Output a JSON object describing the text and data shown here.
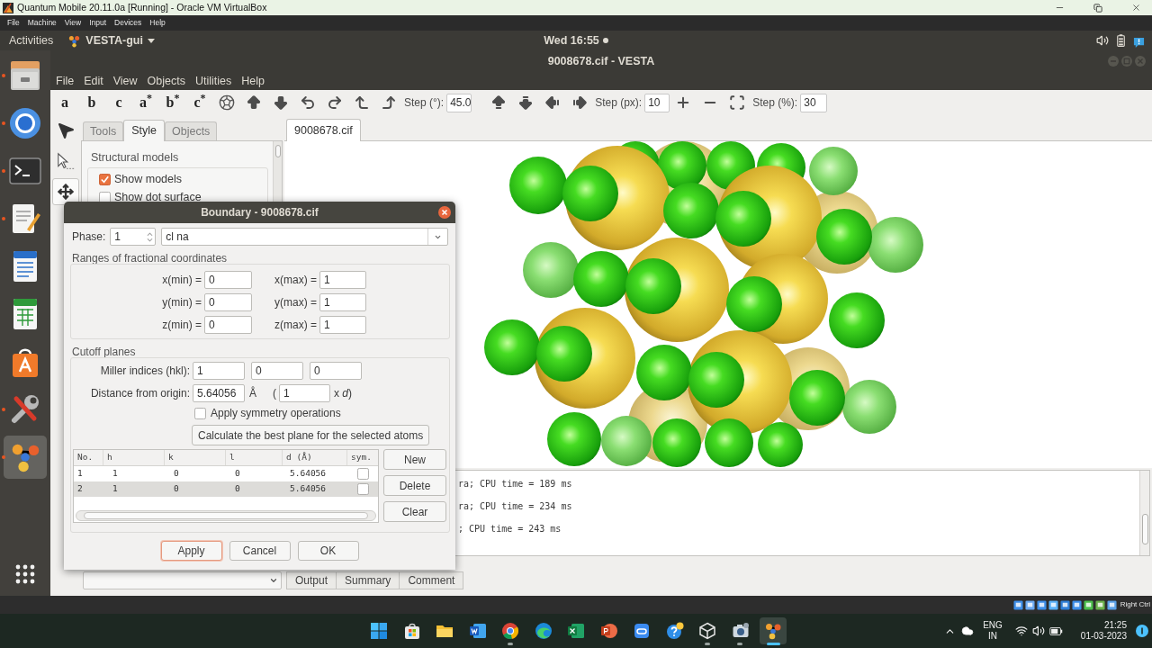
{
  "vm_window": {
    "title": "Quantum Mobile 20.11.0a [Running] - Oracle VM VirtualBox",
    "menu": [
      "File",
      "Machine",
      "View",
      "Input",
      "Devices",
      "Help"
    ]
  },
  "top_bar": {
    "activities": "Activities",
    "app_menu": "VESTA-gui",
    "clock": "Wed 16:55"
  },
  "dock": {
    "items": [
      {
        "selected": false,
        "running": true
      },
      {
        "selected": false,
        "running": true
      },
      {
        "selected": false,
        "running": true
      },
      {
        "selected": false,
        "running": true
      },
      {
        "selected": false,
        "running": false
      },
      {
        "selected": false,
        "running": false
      },
      {
        "selected": false,
        "running": false
      },
      {
        "selected": false,
        "running": true
      },
      {
        "selected": true,
        "running": true
      }
    ]
  },
  "vesta": {
    "title": "9008678.cif - VESTA",
    "menu": [
      "File",
      "Edit",
      "View",
      "Objects",
      "Utilities",
      "Help"
    ],
    "toolbar": {
      "axis_buttons": [
        "a",
        "b",
        "c",
        "a$^{*}$",
        "b$^{*}$",
        "c$^{*}$"
      ],
      "rotation_step": {
        "label": "Step (°):",
        "value": "45.0"
      },
      "translation_step": {
        "label": "Step (px):",
        "value": "10"
      },
      "zoom_step": {
        "label": "Step (%):",
        "value": "30"
      }
    },
    "tools": [
      {
        "selected": false
      },
      {
        "selected": false
      },
      {
        "selected": true
      }
    ],
    "side_panel": {
      "tabs": [
        {
          "label": "Tools",
          "selected": false
        },
        {
          "label": "Style",
          "selected": true
        },
        {
          "label": "Objects",
          "selected": false
        }
      ],
      "group_title": "Structural models",
      "options": [
        {
          "label": "Show models",
          "checked": true
        },
        {
          "label": "Show dot surface",
          "checked": false
        }
      ]
    },
    "document_tabs": [
      {
        "label": "9008678.cif",
        "selected": true
      }
    ],
    "output_lines": [
      "ra; CPU time = 189 ms",
      "ra; CPU time = 234 ms",
      "; CPU time = 243 ms"
    ],
    "bottom_tabs": [
      "Output",
      "Summary",
      "Comment"
    ]
  },
  "boundary_dialog": {
    "title": "Boundary - 9008678.cif",
    "phase": {
      "label": "Phase:",
      "value": "1",
      "name": "cl na"
    },
    "ranges": {
      "title": "Ranges of fractional coordinates",
      "rows": [
        {
          "min": {
            "label": "x(min) =",
            "value": "0"
          },
          "max": {
            "label": "x(max) =",
            "value": "1"
          }
        },
        {
          "min": {
            "label": "y(min) =",
            "value": "0"
          },
          "max": {
            "label": "y(max) =",
            "value": "1"
          }
        },
        {
          "min": {
            "label": "z(min) =",
            "value": "0"
          },
          "max": {
            "label": "z(max) =",
            "value": "1"
          }
        }
      ]
    },
    "cutoff": {
      "title": "Cutoff planes",
      "miller": {
        "label": "Miller indices (hkl):",
        "values": [
          "1",
          "0",
          "0"
        ]
      },
      "distance": {
        "label": "Distance from origin:",
        "value": "5.64056",
        "unit": "Å",
        "open": "(",
        "factor": "1",
        "factor_unit": "x *d*)"
      },
      "symmetry": {
        "label": "Apply symmetry operations",
        "checked": false
      },
      "best_plane_button": "Calculate the best plane for the selected atoms",
      "table": {
        "columns": [
          "No.",
          "h",
          "k",
          "l",
          "d (Å)",
          "sym."
        ],
        "rows": [
          {
            "cells": [
              "1",
              "1",
              "0",
              "0",
              "5.64056"
            ],
            "sym": false,
            "selected": false
          },
          {
            "cells": [
              "2",
              "1",
              "0",
              "0",
              "5.64056"
            ],
            "sym": false,
            "selected": true
          }
        ]
      },
      "side_buttons": [
        "New",
        "Delete",
        "Clear"
      ]
    },
    "buttons": [
      {
        "label": "Apply",
        "focused": true
      },
      {
        "label": "Cancel",
        "focused": false
      },
      {
        "label": "OK",
        "focused": false
      }
    ]
  },
  "vm_status_bar": {
    "host_key": "Right Ctrl"
  },
  "taskbar": {
    "apps": [
      {
        "selected": false,
        "running": false
      },
      {
        "selected": false,
        "running": false
      },
      {
        "selected": false,
        "running": false
      },
      {
        "selected": false,
        "running": false
      },
      {
        "selected": false,
        "running": true
      },
      {
        "selected": false,
        "running": false
      },
      {
        "selected": false,
        "running": false
      },
      {
        "selected": false,
        "running": false
      },
      {
        "selected": false,
        "running": false
      },
      {
        "selected": false,
        "running": false
      },
      {
        "selected": false,
        "running": true
      },
      {
        "selected": false,
        "running": true
      },
      {
        "selected": true,
        "running": true
      }
    ],
    "tray": {
      "language": "ENG",
      "region": "IN",
      "time": "21:25",
      "date": "01-03-2023"
    }
  }
}
